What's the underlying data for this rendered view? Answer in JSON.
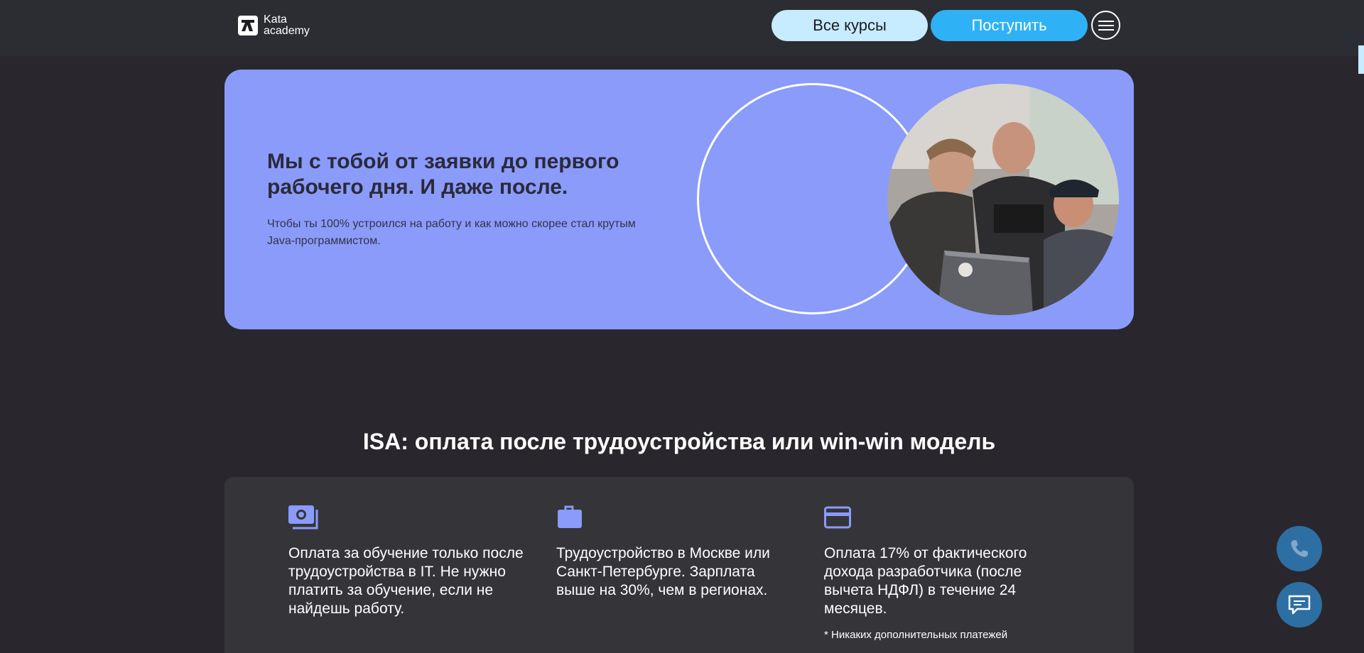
{
  "header": {
    "logo_line1": "Kata",
    "logo_line2": "academy",
    "courses_label": "Все курсы",
    "apply_label": "Поступить"
  },
  "hero": {
    "title": "Мы с тобой от заявки до первого рабочего дня. И даже после.",
    "text": "Чтобы ты 100% устроился на работу и как можно скорее стал крутым Java-программистом."
  },
  "isa": {
    "title": "ISA: оплата после трудоустройства или win-win модель",
    "features": [
      {
        "icon": "cash-icon",
        "text": "Оплата за обучение только после трудоустройства в IT. Не нужно платить за обучение, если не найдешь работу."
      },
      {
        "icon": "briefcase-icon",
        "text": "Трудоустройство в Москве или Санкт-Петербурге. Зарплата выше на 30%, чем в  регионах."
      },
      {
        "icon": "credit-card-icon",
        "text": "Оплата 17% от фактического дохода разработчика (после вычета НДФЛ) в течение 24 месяцев.",
        "note": "* Никаких дополнительных платежей"
      }
    ]
  },
  "colors": {
    "accent_blue": "#2fb1f6",
    "light_blue": "#c7ebff",
    "hero_bg": "#8a9bfa",
    "page_bg": "#29272d",
    "icon_color": "#8a9bfa"
  }
}
